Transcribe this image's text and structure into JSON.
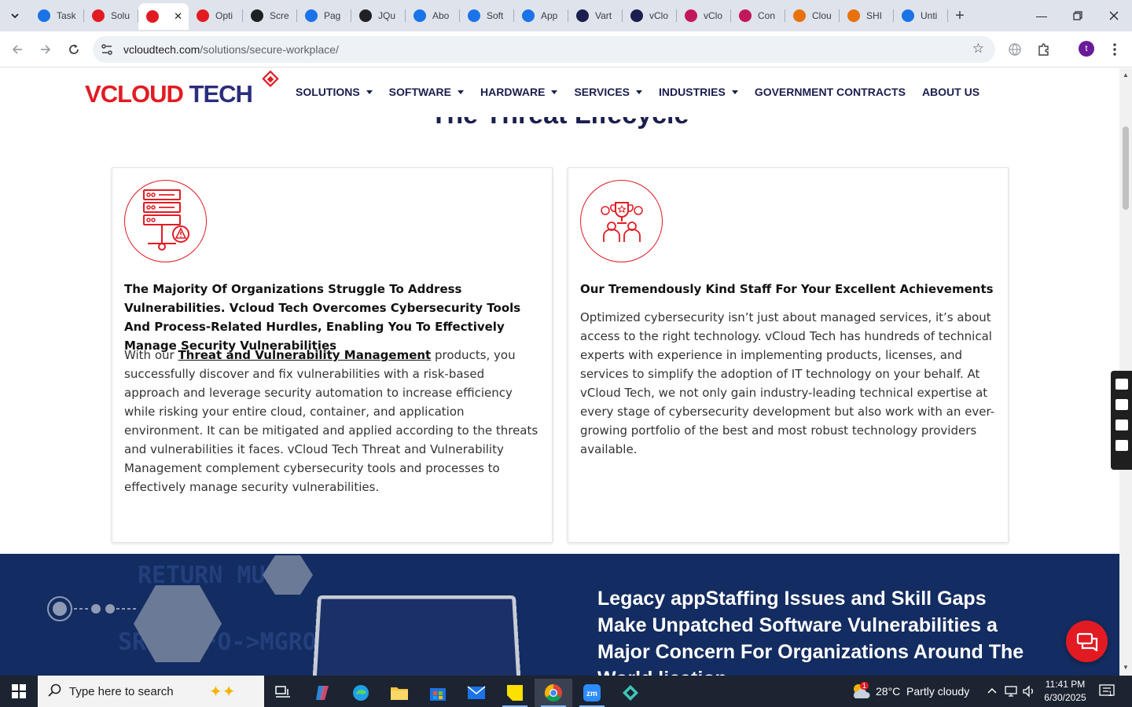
{
  "browser": {
    "tabs": [
      {
        "label": "Task",
        "color": "#1a73e8"
      },
      {
        "label": "Solu",
        "color": "#e21b23"
      },
      {
        "label": "",
        "color": "#e21b23",
        "active": true
      },
      {
        "label": "Opti",
        "color": "#e21b23"
      },
      {
        "label": "Scre",
        "color": "#202124"
      },
      {
        "label": "Pag",
        "color": "#1a73e8"
      },
      {
        "label": "JQu",
        "color": "#202124"
      },
      {
        "label": "Abo",
        "color": "#1a73e8"
      },
      {
        "label": "Soft",
        "color": "#1a73e8"
      },
      {
        "label": "App",
        "color": "#1a73e8"
      },
      {
        "label": "Vart",
        "color": "#1b1e4e"
      },
      {
        "label": "vClo",
        "color": "#1b1e4e"
      },
      {
        "label": "vClo",
        "color": "#c2185b"
      },
      {
        "label": "Con",
        "color": "#c2185b"
      },
      {
        "label": "Clou",
        "color": "#e8710a"
      },
      {
        "label": "SHI",
        "color": "#e8710a"
      },
      {
        "label": "Unti",
        "color": "#1a73e8"
      }
    ],
    "url_host": "vcloudtech.com",
    "url_path": "/solutions/secure-workplace/",
    "profile_initial": "t"
  },
  "site": {
    "logo_v": "V",
    "logo_cloud": "CLOUD",
    "logo_tech": " TECH",
    "nav": [
      {
        "label": "SOLUTIONS",
        "dropdown": true
      },
      {
        "label": "SOFTWARE",
        "dropdown": true
      },
      {
        "label": "HARDWARE",
        "dropdown": true
      },
      {
        "label": "SERVICES",
        "dropdown": true
      },
      {
        "label": "INDUSTRIES",
        "dropdown": true
      },
      {
        "label": "GOVERNMENT CONTRACTS",
        "dropdown": false
      },
      {
        "label": "ABOUT US",
        "dropdown": false
      }
    ]
  },
  "section": {
    "title": "The Threat Lifecycle",
    "cards": [
      {
        "icon": "server-warning-icon",
        "heading": "The Majority Of Organizations Struggle To Address Vulnerabilities. Vcloud Tech Overcomes Cybersecurity Tools And Process-Related Hurdles, Enabling You To Effectively Manage Security Vulnerabilities",
        "body_prefix": "With our ",
        "body_link": "Threat and Vulnerability Management",
        "body_suffix": " products, you successfully discover and fix vulnerabilities with a risk-based approach and leverage security automation to increase efficiency while risking your entire cloud, container, and application environment. It can be mitigated and applied according to the threats and vulnerabilities it faces. vCloud Tech Threat and Vulnerability Management complement cybersecurity tools and processes to effectively manage security vulnerabilities."
      },
      {
        "icon": "trophy-team-icon",
        "heading": "Our Tremendously Kind Staff For Your Excellent Achievements",
        "body": "Optimized cybersecurity isn’t just about managed services, it’s about access to the right technology. vCloud Tech has hundreds of technical experts with experience in implementing products, licenses, and services to simplify the adoption of IT technology on your behalf. At vCloud Tech, we not only gain industry-leading technical expertise at every stage of cybersecurity development but also work with an ever-growing portfolio of the best and most robust technology providers available."
      }
    ]
  },
  "banner": {
    "heading": "Legacy appStaffing Issues and Skill Gaps Make Unpatched Software Vulnerabilities a Major Concern For Organizations Around The World.lication",
    "ghost_text_1": "RETURN MUL",
    "ghost_text_2": "SREGINFO->MGROU"
  },
  "taskbar": {
    "search_placeholder": "Type here to search",
    "weather": "28°C  Partly cloudy",
    "weather_badge": "1",
    "time": "11:41 PM",
    "date": "6/30/2025",
    "notification_count": "1"
  },
  "colors": {
    "brand_red": "#e21b23",
    "brand_navy": "#1b1e4e",
    "banner_bg": "#132c61"
  }
}
